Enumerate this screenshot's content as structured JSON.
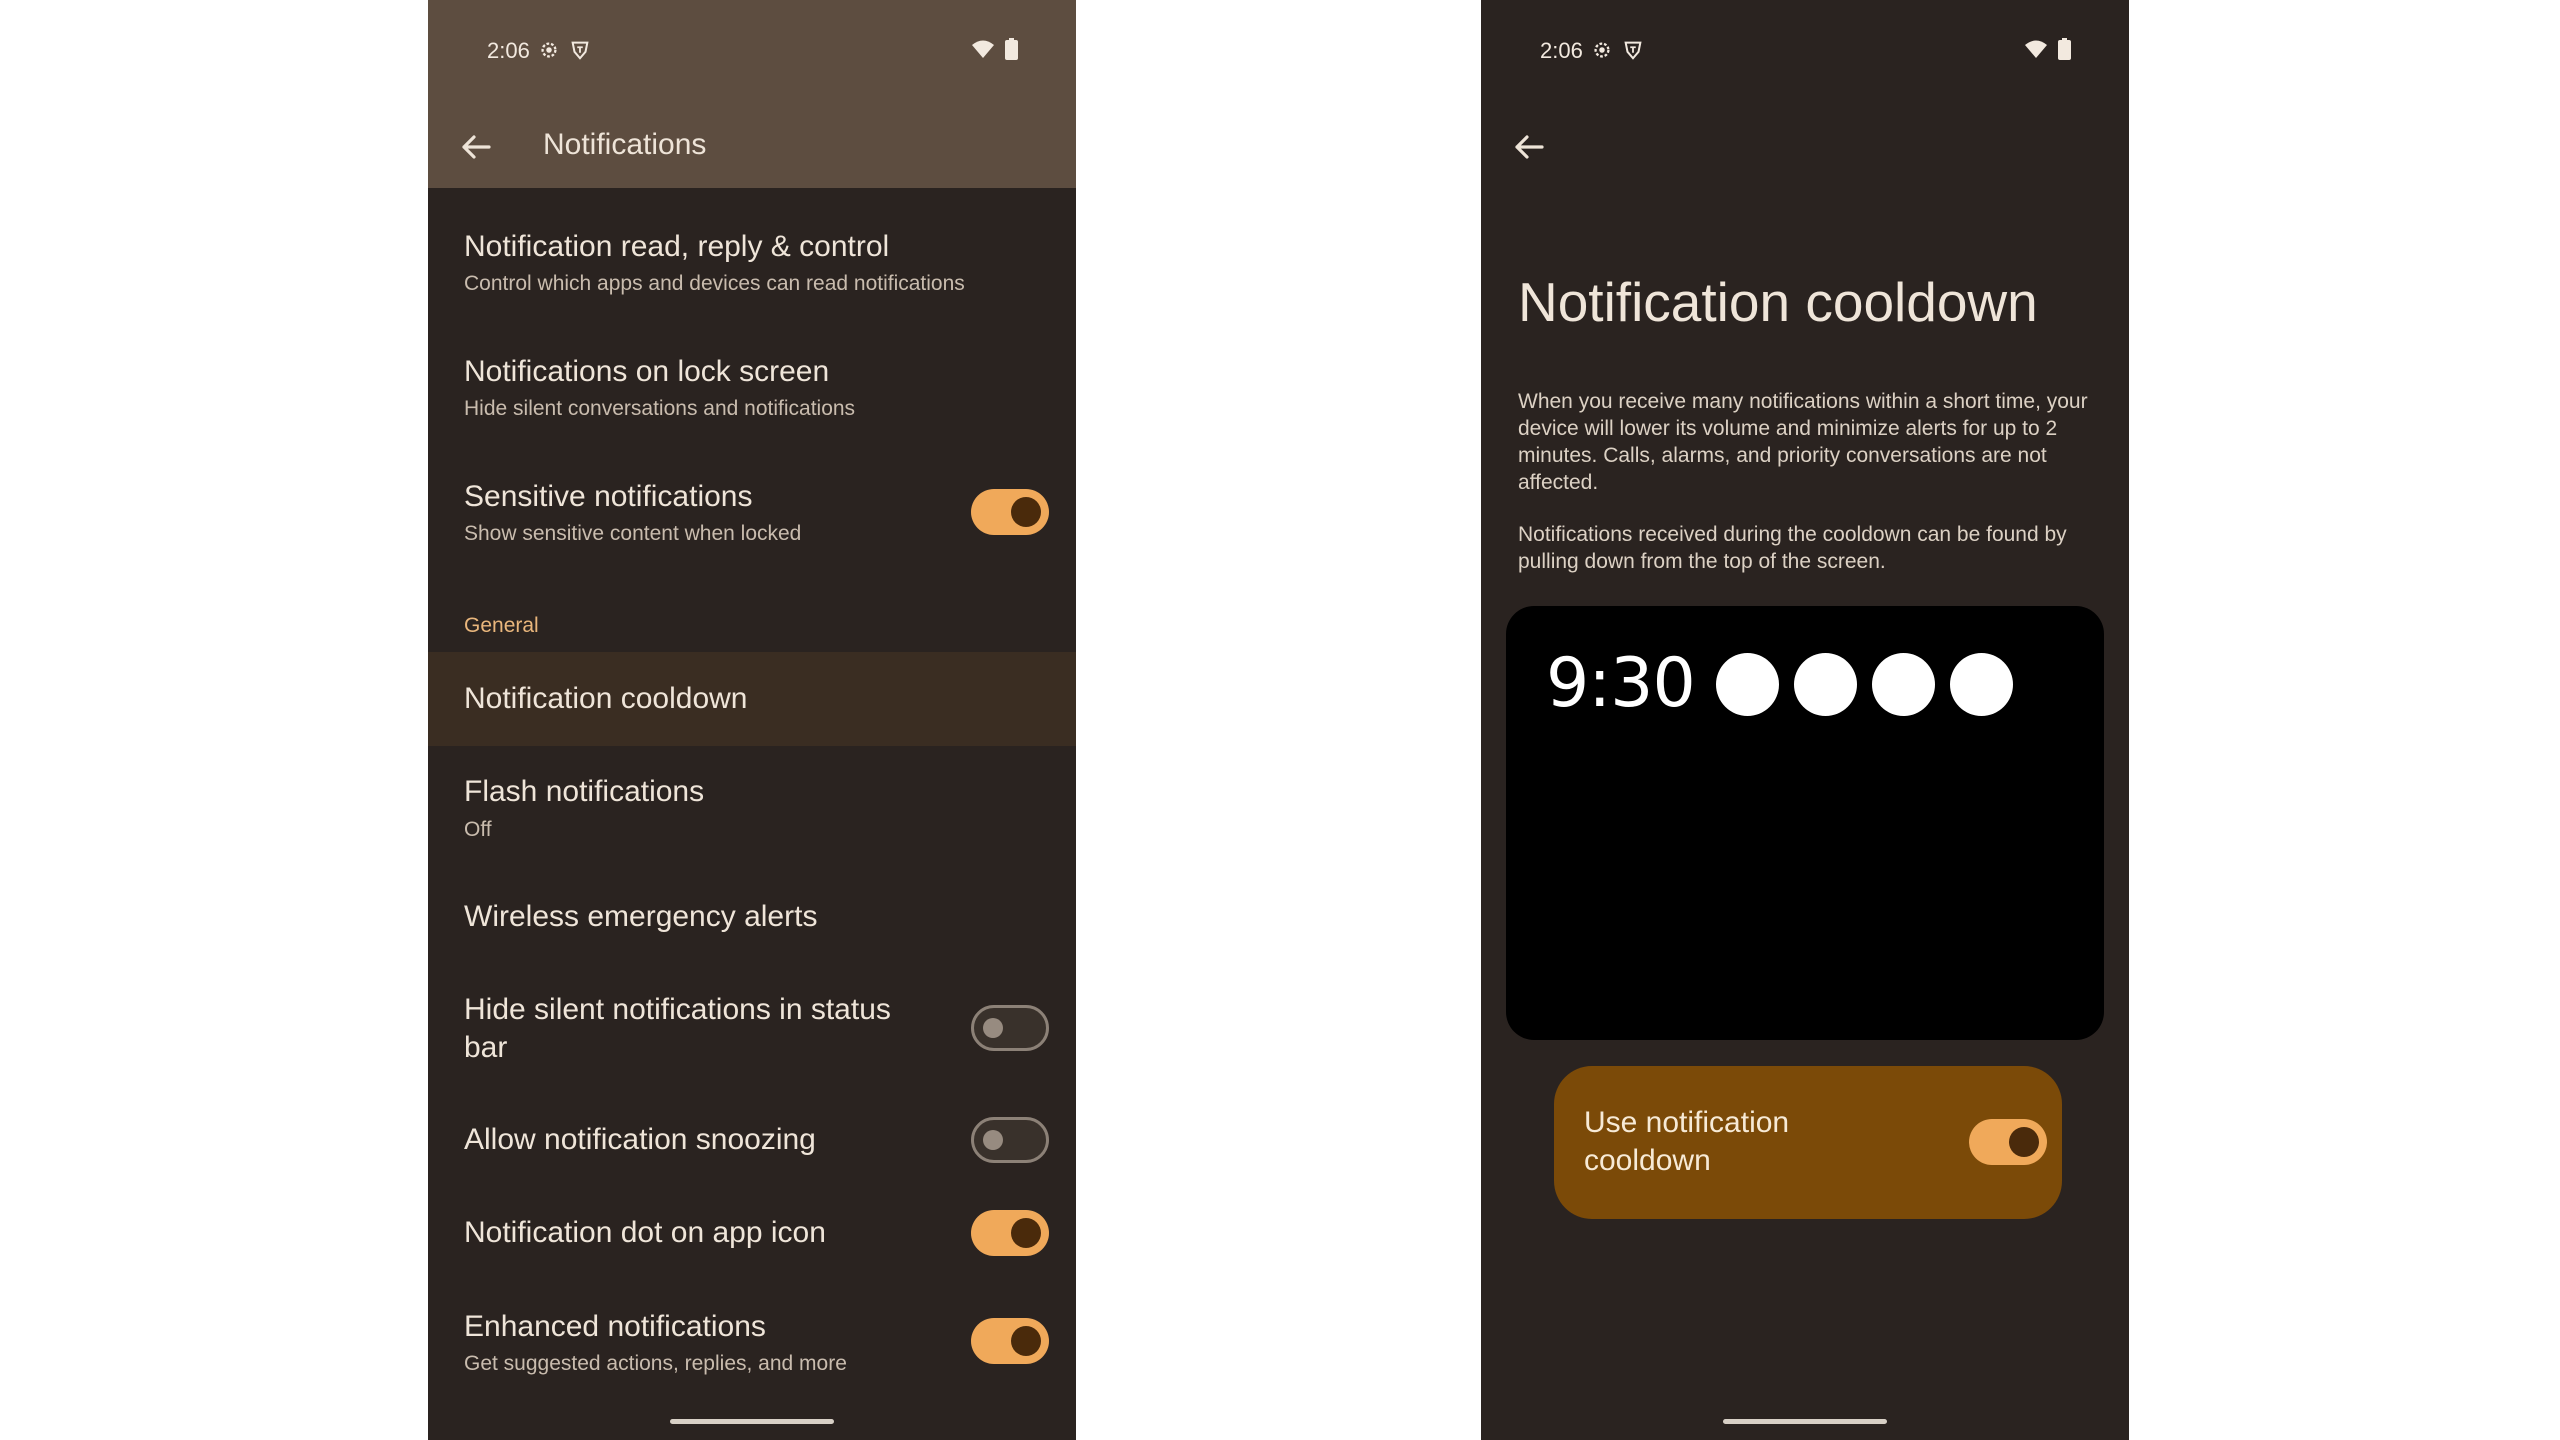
{
  "left_screen": {
    "status_bar": {
      "time": "2:06"
    },
    "app_bar": {
      "title": "Notifications"
    },
    "items": [
      {
        "title": "Notification read, reply & control",
        "subtitle": "Control which apps and devices can read notifications"
      },
      {
        "title": "Notifications on lock screen",
        "subtitle": "Hide silent conversations and notifications"
      },
      {
        "title": "Sensitive notifications",
        "subtitle": "Show sensitive content when locked",
        "toggle": "on"
      }
    ],
    "section_header": "General",
    "general_items": [
      {
        "title": "Notification cooldown"
      },
      {
        "title": "Flash notifications",
        "subtitle": "Off"
      },
      {
        "title": "Wireless emergency alerts"
      },
      {
        "title": "Hide silent notifications in status bar",
        "toggle": "off"
      },
      {
        "title": "Allow notification snoozing",
        "toggle": "off"
      },
      {
        "title": "Notification dot on app icon",
        "toggle": "on"
      },
      {
        "title": "Enhanced notifications",
        "subtitle": "Get suggested actions, replies, and more",
        "toggle": "on"
      }
    ]
  },
  "right_screen": {
    "status_bar": {
      "time": "2:06"
    },
    "title": "Notification cooldown",
    "description_1": "When you receive many notifications within a short time, your device will lower its volume and minimize alerts for up to 2 minutes. Calls, alarms, and priority conversations are not affected.",
    "description_2": "Notifications received during the cooldown can be found by pulling down from the top of the screen.",
    "preview": {
      "time": "9:30",
      "dot_count": 4
    },
    "main_toggle": {
      "label": "Use notification cooldown",
      "state": "on"
    }
  },
  "colors": {
    "background": "#2a2320",
    "accent": "#f0a95a",
    "section_header": "#e9b67c",
    "highlight_row": "#3a2d22",
    "card": "#7b4a08"
  },
  "icons": {
    "status_bar": [
      "settings-icon",
      "shield-icon",
      "wifi-icon",
      "battery-icon"
    ],
    "navigation": "back-arrow-icon"
  }
}
